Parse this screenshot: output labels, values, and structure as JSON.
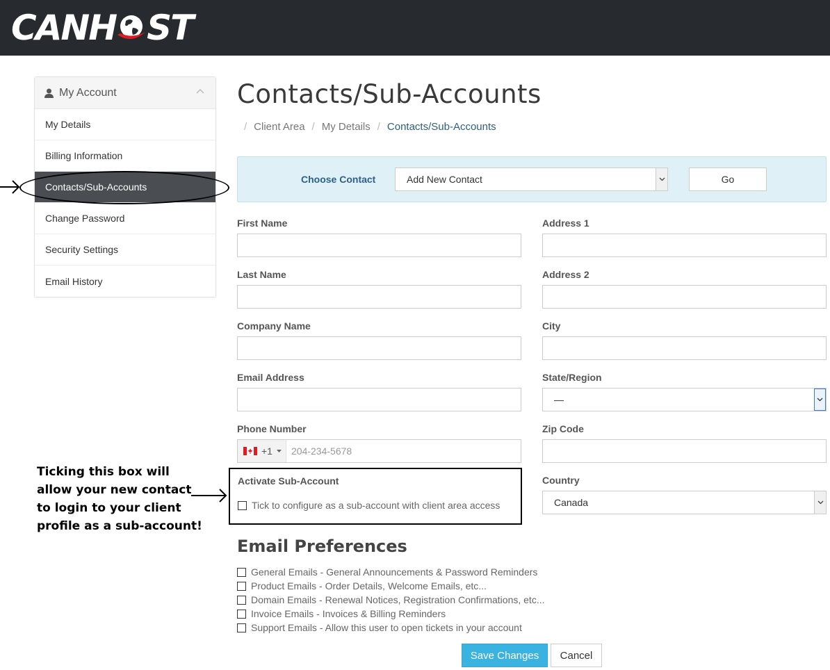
{
  "header": {
    "logo_text": "CANHOST"
  },
  "sidebar": {
    "title": "My Account",
    "items": [
      {
        "label": "My Details"
      },
      {
        "label": "Billing Information"
      },
      {
        "label": "Contacts/Sub-Accounts",
        "active": true
      },
      {
        "label": "Change Password"
      },
      {
        "label": "Security Settings"
      },
      {
        "label": "Email History"
      }
    ]
  },
  "page": {
    "title": "Contacts/Sub-Accounts",
    "breadcrumb": [
      "Client Area",
      "My Details",
      "Contacts/Sub-Accounts"
    ]
  },
  "choose_contact": {
    "label": "Choose Contact",
    "selected": "Add New Contact",
    "go_label": "Go"
  },
  "form": {
    "first_name": {
      "label": "First Name",
      "value": ""
    },
    "last_name": {
      "label": "Last Name",
      "value": ""
    },
    "company_name": {
      "label": "Company Name",
      "value": ""
    },
    "email_address": {
      "label": "Email Address",
      "value": ""
    },
    "phone_number": {
      "label": "Phone Number",
      "country_code": "+1",
      "placeholder": "204-234-5678"
    },
    "address1": {
      "label": "Address 1",
      "value": ""
    },
    "address2": {
      "label": "Address 2",
      "value": ""
    },
    "city": {
      "label": "City",
      "value": ""
    },
    "state_region": {
      "label": "State/Region",
      "selected": "—"
    },
    "zip_code": {
      "label": "Zip Code",
      "value": ""
    },
    "country": {
      "label": "Country",
      "selected": "Canada"
    }
  },
  "sub_account": {
    "label": "Activate Sub-Account",
    "checkbox_label": "Tick to configure as a sub-account with client area access",
    "checked": false
  },
  "annotation": {
    "text": "Ticking this box will allow your new contact to login to your client profile as a sub-account!"
  },
  "email_preferences": {
    "title": "Email Preferences",
    "items": [
      {
        "label": "General Emails - General Announcements & Password Reminders",
        "checked": false
      },
      {
        "label": "Product Emails - Order Details, Welcome Emails, etc...",
        "checked": false
      },
      {
        "label": "Domain Emails - Renewal Notices, Registration Confirmations, etc...",
        "checked": false
      },
      {
        "label": "Invoice Emails - Invoices & Billing Reminders",
        "checked": false
      },
      {
        "label": "Support Emails - Allow this user to open tickets in your account",
        "checked": false
      }
    ]
  },
  "actions": {
    "save_label": "Save Changes",
    "cancel_label": "Cancel"
  },
  "colors": {
    "topbar": "#272b30",
    "accent": "#3bb3e0",
    "active_sidebar": "#4a4e52",
    "panel_bg": "#dff0f7",
    "logo_red": "#e21b23"
  }
}
